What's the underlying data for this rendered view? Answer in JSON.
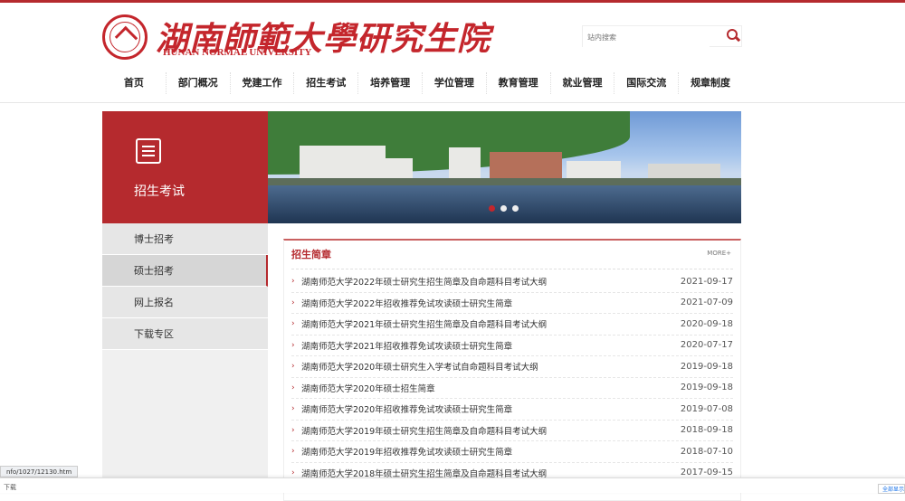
{
  "header": {
    "brand": "湖南師範大學研究生院",
    "brand_en": "HUNAN NORMAL UNIVERSITY",
    "search_placeholder": "站内搜索"
  },
  "nav": [
    "首页",
    "部门概况",
    "党建工作",
    "招生考试",
    "培养管理",
    "学位管理",
    "教育管理",
    "就业管理",
    "国际交流",
    "规章制度"
  ],
  "sidebar": {
    "title": "招生考试",
    "items": [
      "博士招考",
      "硕士招考",
      "网上报名",
      "下载专区"
    ],
    "active": 1
  },
  "panel": {
    "title": "招生简章",
    "more": "MORE+",
    "items": [
      {
        "title": "湖南师范大学2022年硕士研究生招生简章及自命题科目考试大纲",
        "date": "2021-09-17"
      },
      {
        "title": "湖南师范大学2022年招收推荐免试攻读硕士研究生简章",
        "date": "2021-07-09"
      },
      {
        "title": "湖南师范大学2021年硕士研究生招生简章及自命题科目考试大纲",
        "date": "2020-09-18"
      },
      {
        "title": "湖南师范大学2021年招收推荐免试攻读硕士研究生简章",
        "date": "2020-07-17"
      },
      {
        "title": "湖南师范大学2020年硕士研究生入学考试自命题科目考试大纲",
        "date": "2019-09-18"
      },
      {
        "title": "湖南师范大学2020年硕士招生简章",
        "date": "2019-09-18"
      },
      {
        "title": "湖南师范大学2020年招收推荐免试攻读硕士研究生简章",
        "date": "2019-07-08"
      },
      {
        "title": "湖南师范大学2019年硕士研究生招生简章及自命题科目考试大纲",
        "date": "2018-09-18"
      },
      {
        "title": "湖南师范大学2019年招收推荐免试攻读硕士研究生简章",
        "date": "2018-07-10"
      },
      {
        "title": "湖南师范大学2018年硕士研究生招生简章及自命题科目考试大纲",
        "date": "2017-09-15"
      }
    ]
  },
  "status_url": "nfo/1027/12130.htm",
  "download_bar": {
    "file": "下载",
    "button": "全部显示"
  },
  "colors": {
    "accent": "#b52a2e"
  }
}
